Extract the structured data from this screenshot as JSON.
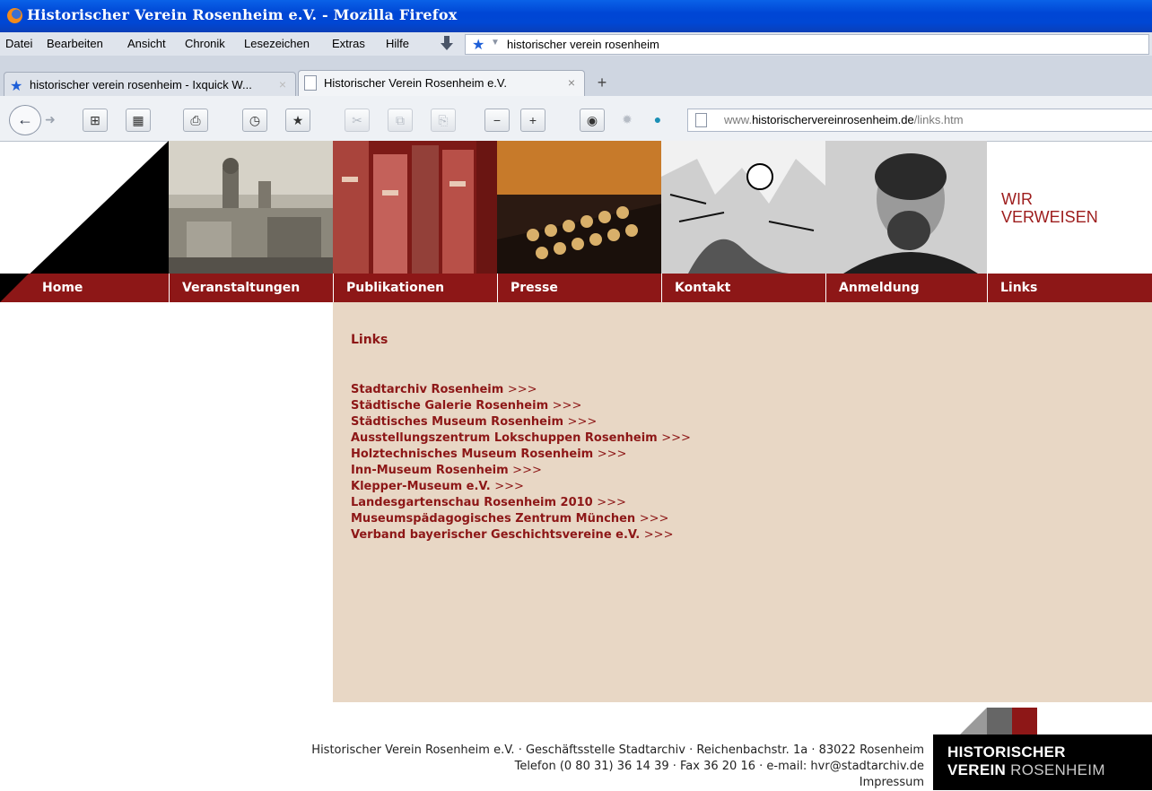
{
  "window": {
    "title": "Historischer Verein Rosenheim e.V. - Mozilla Firefox"
  },
  "menu": [
    "Datei",
    "Bearbeiten",
    "Ansicht",
    "Chronik",
    "Lesezeichen",
    "Extras",
    "Hilfe"
  ],
  "search": {
    "query": "historischer verein rosenheim",
    "engine_icon": "star-icon"
  },
  "tabs": [
    {
      "label": "historischer verein rosenheim - Ixquick W...",
      "icon": "star-icon",
      "active": false
    },
    {
      "label": "Historischer Verein Rosenheim e.V.",
      "icon": "page-icon",
      "active": true
    }
  ],
  "toolbar": {
    "zoom_out": "−",
    "zoom_in": "+"
  },
  "url": {
    "prefix": "www.",
    "domain": "historischervereinrosenheim.de",
    "path": "/links.htm"
  },
  "header": {
    "tagline_line1": "WIR",
    "tagline_line2": "VERWEISEN"
  },
  "nav": [
    "Home",
    "Veranstaltungen",
    "Publikationen",
    "Presse",
    "Kontakt",
    "Anmeldung",
    "Links"
  ],
  "content": {
    "title": "Links",
    "arrow": ">>>",
    "links": [
      "Stadtarchiv Rosenheim",
      "Städtische Galerie Rosenheim",
      "Städtisches Museum Rosenheim",
      "Ausstellungszentrum Lokschuppen Rosenheim",
      "Holztechnisches Museum Rosenheim",
      "Inn-Museum Rosenheim",
      "Klepper-Museum e.V.",
      "Landesgartenschau Rosenheim 2010",
      "Museumspädagogisches Zentrum München",
      "Verband bayerischer Geschichtsvereine e.V."
    ]
  },
  "footer": {
    "line1": "Historischer Verein Rosenheim e.V. · Geschäftsstelle Stadtarchiv · Reichenbachstr. 1a · 83022 Rosenheim",
    "line2": "Telefon (0 80 31) 36 14 39 · Fax 36 20 16 · e-mail: hvr@stadtarchiv.de",
    "impressum": "Impressum"
  },
  "logo": {
    "line1": "HISTORISCHER",
    "line2_bold": "VEREIN",
    "line2_light": "ROSENHEIM"
  },
  "colors": {
    "brand": "#8d1717",
    "content_bg": "#e8d7c5",
    "titlebar": "#0046d5"
  }
}
